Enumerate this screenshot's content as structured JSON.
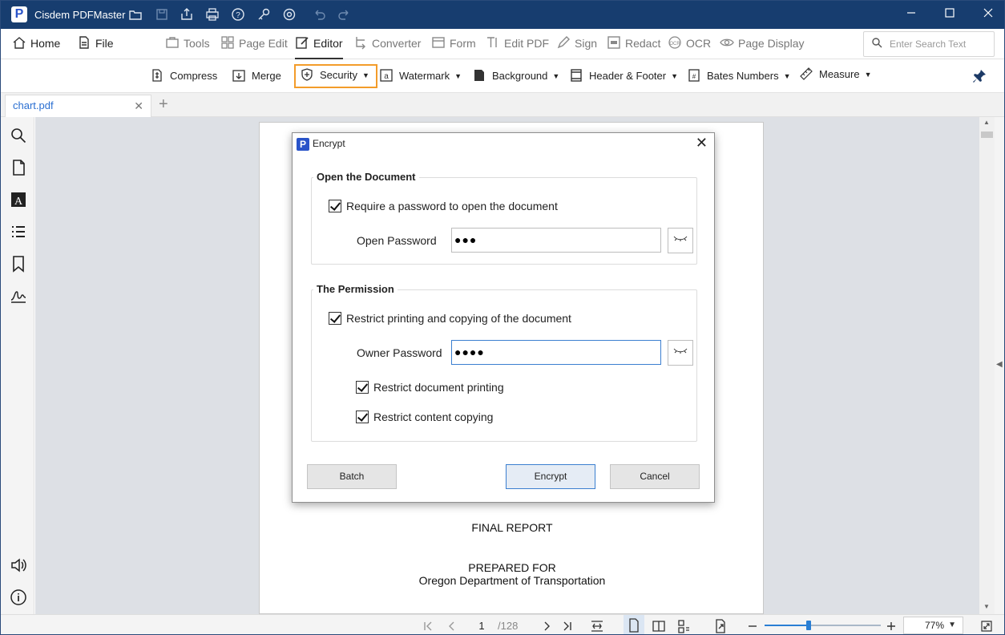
{
  "app": {
    "name": "Cisdem PDFMaster"
  },
  "menu": {
    "home": "Home",
    "file": "File",
    "tools": "Tools",
    "page_edit": "Page Edit",
    "editor": "Editor",
    "converter": "Converter",
    "form": "Form",
    "edit_pdf": "Edit PDF",
    "sign": "Sign",
    "redact": "Redact",
    "ocr": "OCR",
    "page_display": "Page Display",
    "search_placeholder": "Enter Search Text"
  },
  "toolbar": {
    "compress": "Compress",
    "merge": "Merge",
    "security": "Security",
    "watermark": "Watermark",
    "background": "Background",
    "header_footer": "Header & Footer",
    "bates_numbers": "Bates Numbers",
    "measure": "Measure"
  },
  "tab": {
    "filename": "chart.pdf"
  },
  "document": {
    "line1": "FINAL REPORT",
    "line2": "PREPARED FOR",
    "line3": "Oregon Department of Transportation"
  },
  "dialog": {
    "title": "Encrypt",
    "open_section": "Open the Document",
    "require_password": "Require a password to open the document",
    "open_password_label": "Open Password",
    "open_password_value": "●●●",
    "permission_section": "The Permission",
    "restrict_printing_copying": "Restrict printing and copying of the document",
    "owner_password_label": "Owner Password",
    "owner_password_value": "●●●●",
    "restrict_printing": "Restrict document printing",
    "restrict_copying": "Restrict content copying",
    "batch": "Batch",
    "encrypt": "Encrypt",
    "cancel": "Cancel"
  },
  "status": {
    "page": "1",
    "total": "/128",
    "zoom": "77%",
    "zoom_level": 0.38
  }
}
